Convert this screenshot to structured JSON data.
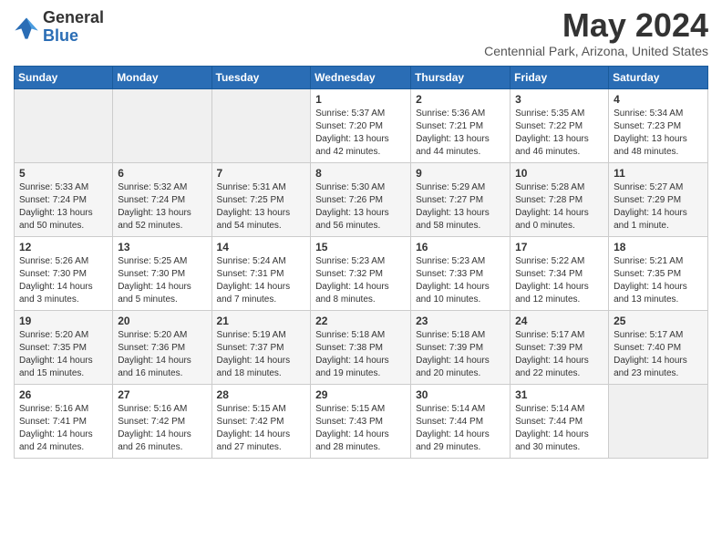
{
  "logo": {
    "general": "General",
    "blue": "Blue"
  },
  "title": "May 2024",
  "subtitle": "Centennial Park, Arizona, United States",
  "days_header": [
    "Sunday",
    "Monday",
    "Tuesday",
    "Wednesday",
    "Thursday",
    "Friday",
    "Saturday"
  ],
  "weeks": [
    [
      {
        "day": "",
        "info": ""
      },
      {
        "day": "",
        "info": ""
      },
      {
        "day": "",
        "info": ""
      },
      {
        "day": "1",
        "info": "Sunrise: 5:37 AM\nSunset: 7:20 PM\nDaylight: 13 hours\nand 42 minutes."
      },
      {
        "day": "2",
        "info": "Sunrise: 5:36 AM\nSunset: 7:21 PM\nDaylight: 13 hours\nand 44 minutes."
      },
      {
        "day": "3",
        "info": "Sunrise: 5:35 AM\nSunset: 7:22 PM\nDaylight: 13 hours\nand 46 minutes."
      },
      {
        "day": "4",
        "info": "Sunrise: 5:34 AM\nSunset: 7:23 PM\nDaylight: 13 hours\nand 48 minutes."
      }
    ],
    [
      {
        "day": "5",
        "info": "Sunrise: 5:33 AM\nSunset: 7:24 PM\nDaylight: 13 hours\nand 50 minutes."
      },
      {
        "day": "6",
        "info": "Sunrise: 5:32 AM\nSunset: 7:24 PM\nDaylight: 13 hours\nand 52 minutes."
      },
      {
        "day": "7",
        "info": "Sunrise: 5:31 AM\nSunset: 7:25 PM\nDaylight: 13 hours\nand 54 minutes."
      },
      {
        "day": "8",
        "info": "Sunrise: 5:30 AM\nSunset: 7:26 PM\nDaylight: 13 hours\nand 56 minutes."
      },
      {
        "day": "9",
        "info": "Sunrise: 5:29 AM\nSunset: 7:27 PM\nDaylight: 13 hours\nand 58 minutes."
      },
      {
        "day": "10",
        "info": "Sunrise: 5:28 AM\nSunset: 7:28 PM\nDaylight: 14 hours\nand 0 minutes."
      },
      {
        "day": "11",
        "info": "Sunrise: 5:27 AM\nSunset: 7:29 PM\nDaylight: 14 hours\nand 1 minute."
      }
    ],
    [
      {
        "day": "12",
        "info": "Sunrise: 5:26 AM\nSunset: 7:30 PM\nDaylight: 14 hours\nand 3 minutes."
      },
      {
        "day": "13",
        "info": "Sunrise: 5:25 AM\nSunset: 7:30 PM\nDaylight: 14 hours\nand 5 minutes."
      },
      {
        "day": "14",
        "info": "Sunrise: 5:24 AM\nSunset: 7:31 PM\nDaylight: 14 hours\nand 7 minutes."
      },
      {
        "day": "15",
        "info": "Sunrise: 5:23 AM\nSunset: 7:32 PM\nDaylight: 14 hours\nand 8 minutes."
      },
      {
        "day": "16",
        "info": "Sunrise: 5:23 AM\nSunset: 7:33 PM\nDaylight: 14 hours\nand 10 minutes."
      },
      {
        "day": "17",
        "info": "Sunrise: 5:22 AM\nSunset: 7:34 PM\nDaylight: 14 hours\nand 12 minutes."
      },
      {
        "day": "18",
        "info": "Sunrise: 5:21 AM\nSunset: 7:35 PM\nDaylight: 14 hours\nand 13 minutes."
      }
    ],
    [
      {
        "day": "19",
        "info": "Sunrise: 5:20 AM\nSunset: 7:35 PM\nDaylight: 14 hours\nand 15 minutes."
      },
      {
        "day": "20",
        "info": "Sunrise: 5:20 AM\nSunset: 7:36 PM\nDaylight: 14 hours\nand 16 minutes."
      },
      {
        "day": "21",
        "info": "Sunrise: 5:19 AM\nSunset: 7:37 PM\nDaylight: 14 hours\nand 18 minutes."
      },
      {
        "day": "22",
        "info": "Sunrise: 5:18 AM\nSunset: 7:38 PM\nDaylight: 14 hours\nand 19 minutes."
      },
      {
        "day": "23",
        "info": "Sunrise: 5:18 AM\nSunset: 7:39 PM\nDaylight: 14 hours\nand 20 minutes."
      },
      {
        "day": "24",
        "info": "Sunrise: 5:17 AM\nSunset: 7:39 PM\nDaylight: 14 hours\nand 22 minutes."
      },
      {
        "day": "25",
        "info": "Sunrise: 5:17 AM\nSunset: 7:40 PM\nDaylight: 14 hours\nand 23 minutes."
      }
    ],
    [
      {
        "day": "26",
        "info": "Sunrise: 5:16 AM\nSunset: 7:41 PM\nDaylight: 14 hours\nand 24 minutes."
      },
      {
        "day": "27",
        "info": "Sunrise: 5:16 AM\nSunset: 7:42 PM\nDaylight: 14 hours\nand 26 minutes."
      },
      {
        "day": "28",
        "info": "Sunrise: 5:15 AM\nSunset: 7:42 PM\nDaylight: 14 hours\nand 27 minutes."
      },
      {
        "day": "29",
        "info": "Sunrise: 5:15 AM\nSunset: 7:43 PM\nDaylight: 14 hours\nand 28 minutes."
      },
      {
        "day": "30",
        "info": "Sunrise: 5:14 AM\nSunset: 7:44 PM\nDaylight: 14 hours\nand 29 minutes."
      },
      {
        "day": "31",
        "info": "Sunrise: 5:14 AM\nSunset: 7:44 PM\nDaylight: 14 hours\nand 30 minutes."
      },
      {
        "day": "",
        "info": ""
      }
    ]
  ]
}
